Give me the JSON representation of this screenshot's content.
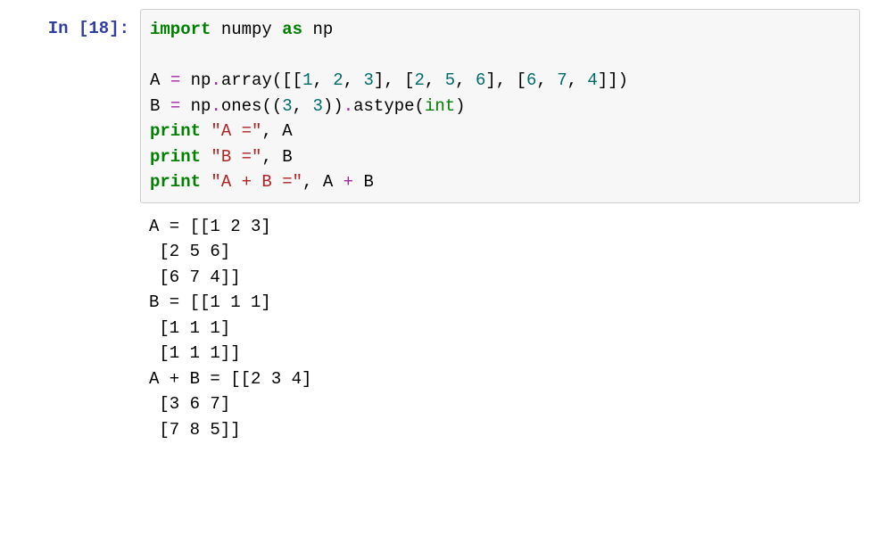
{
  "input_prompt": "In [18]:",
  "code": {
    "line1": {
      "t1": "import",
      "t2": " numpy ",
      "t3": "as",
      "t4": " np"
    },
    "line2": "",
    "line3": {
      "t1": "A ",
      "t2": "=",
      "t3": " np",
      "t4": ".",
      "t5": "array([[",
      "t6": "1",
      "t7": ", ",
      "t8": "2",
      "t9": ", ",
      "t10": "3",
      "t11": "], [",
      "t12": "2",
      "t13": ", ",
      "t14": "5",
      "t15": ", ",
      "t16": "6",
      "t17": "], [",
      "t18": "6",
      "t19": ", ",
      "t20": "7",
      "t21": ", ",
      "t22": "4",
      "t23": "]])"
    },
    "line4": {
      "t1": "B ",
      "t2": "=",
      "t3": " np",
      "t4": ".",
      "t5": "ones((",
      "t6": "3",
      "t7": ", ",
      "t8": "3",
      "t9": "))",
      "t10": ".",
      "t11": "astype(",
      "t12": "int",
      "t13": ")"
    },
    "line5": {
      "t1": "print",
      "t2": " ",
      "t3": "\"A =\"",
      "t4": ", A"
    },
    "line6": {
      "t1": "print",
      "t2": " ",
      "t3": "\"B =\"",
      "t4": ", B"
    },
    "line7": {
      "t1": "print",
      "t2": " ",
      "t3": "\"A + B =\"",
      "t4": ", A ",
      "t5": "+",
      "t6": " B"
    }
  },
  "output": {
    "l1": "A = [[1 2 3]",
    "l2": " [2 5 6]",
    "l3": " [6 7 4]]",
    "l4": "B = [[1 1 1]",
    "l5": " [1 1 1]",
    "l6": " [1 1 1]]",
    "l7": "A + B = [[2 3 4]",
    "l8": " [3 6 7]",
    "l9": " [7 8 5]]"
  }
}
